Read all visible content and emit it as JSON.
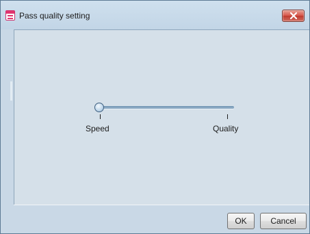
{
  "window": {
    "title": "Pass quality setting",
    "icon": "app-icon"
  },
  "slider": {
    "min_label": "Speed",
    "max_label": "Quality",
    "value_fraction": 0.0
  },
  "buttons": {
    "ok_label": "OK",
    "cancel_label": "Cancel"
  },
  "colors": {
    "title_bar": "#c7d9e8",
    "close_button": "#d04a3e",
    "client_area": "#d5e0e9",
    "slider_track": "#7f9fbd"
  }
}
